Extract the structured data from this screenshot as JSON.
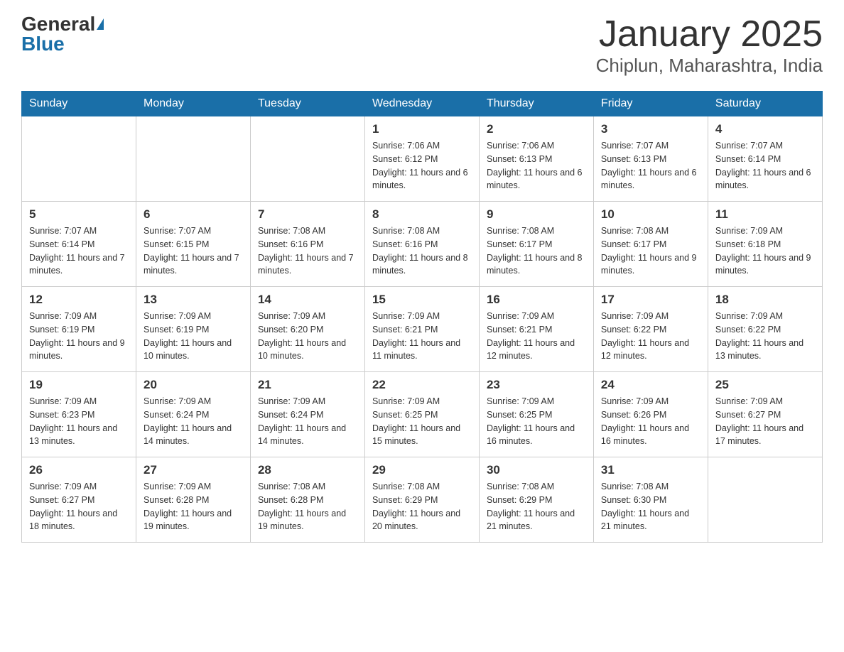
{
  "logo": {
    "general": "General",
    "blue": "Blue"
  },
  "title": "January 2025",
  "location": "Chiplun, Maharashtra, India",
  "headers": [
    "Sunday",
    "Monday",
    "Tuesday",
    "Wednesday",
    "Thursday",
    "Friday",
    "Saturday"
  ],
  "weeks": [
    [
      {
        "day": "",
        "info": ""
      },
      {
        "day": "",
        "info": ""
      },
      {
        "day": "",
        "info": ""
      },
      {
        "day": "1",
        "info": "Sunrise: 7:06 AM\nSunset: 6:12 PM\nDaylight: 11 hours and 6 minutes."
      },
      {
        "day": "2",
        "info": "Sunrise: 7:06 AM\nSunset: 6:13 PM\nDaylight: 11 hours and 6 minutes."
      },
      {
        "day": "3",
        "info": "Sunrise: 7:07 AM\nSunset: 6:13 PM\nDaylight: 11 hours and 6 minutes."
      },
      {
        "day": "4",
        "info": "Sunrise: 7:07 AM\nSunset: 6:14 PM\nDaylight: 11 hours and 6 minutes."
      }
    ],
    [
      {
        "day": "5",
        "info": "Sunrise: 7:07 AM\nSunset: 6:14 PM\nDaylight: 11 hours and 7 minutes."
      },
      {
        "day": "6",
        "info": "Sunrise: 7:07 AM\nSunset: 6:15 PM\nDaylight: 11 hours and 7 minutes."
      },
      {
        "day": "7",
        "info": "Sunrise: 7:08 AM\nSunset: 6:16 PM\nDaylight: 11 hours and 7 minutes."
      },
      {
        "day": "8",
        "info": "Sunrise: 7:08 AM\nSunset: 6:16 PM\nDaylight: 11 hours and 8 minutes."
      },
      {
        "day": "9",
        "info": "Sunrise: 7:08 AM\nSunset: 6:17 PM\nDaylight: 11 hours and 8 minutes."
      },
      {
        "day": "10",
        "info": "Sunrise: 7:08 AM\nSunset: 6:17 PM\nDaylight: 11 hours and 9 minutes."
      },
      {
        "day": "11",
        "info": "Sunrise: 7:09 AM\nSunset: 6:18 PM\nDaylight: 11 hours and 9 minutes."
      }
    ],
    [
      {
        "day": "12",
        "info": "Sunrise: 7:09 AM\nSunset: 6:19 PM\nDaylight: 11 hours and 9 minutes."
      },
      {
        "day": "13",
        "info": "Sunrise: 7:09 AM\nSunset: 6:19 PM\nDaylight: 11 hours and 10 minutes."
      },
      {
        "day": "14",
        "info": "Sunrise: 7:09 AM\nSunset: 6:20 PM\nDaylight: 11 hours and 10 minutes."
      },
      {
        "day": "15",
        "info": "Sunrise: 7:09 AM\nSunset: 6:21 PM\nDaylight: 11 hours and 11 minutes."
      },
      {
        "day": "16",
        "info": "Sunrise: 7:09 AM\nSunset: 6:21 PM\nDaylight: 11 hours and 12 minutes."
      },
      {
        "day": "17",
        "info": "Sunrise: 7:09 AM\nSunset: 6:22 PM\nDaylight: 11 hours and 12 minutes."
      },
      {
        "day": "18",
        "info": "Sunrise: 7:09 AM\nSunset: 6:22 PM\nDaylight: 11 hours and 13 minutes."
      }
    ],
    [
      {
        "day": "19",
        "info": "Sunrise: 7:09 AM\nSunset: 6:23 PM\nDaylight: 11 hours and 13 minutes."
      },
      {
        "day": "20",
        "info": "Sunrise: 7:09 AM\nSunset: 6:24 PM\nDaylight: 11 hours and 14 minutes."
      },
      {
        "day": "21",
        "info": "Sunrise: 7:09 AM\nSunset: 6:24 PM\nDaylight: 11 hours and 14 minutes."
      },
      {
        "day": "22",
        "info": "Sunrise: 7:09 AM\nSunset: 6:25 PM\nDaylight: 11 hours and 15 minutes."
      },
      {
        "day": "23",
        "info": "Sunrise: 7:09 AM\nSunset: 6:25 PM\nDaylight: 11 hours and 16 minutes."
      },
      {
        "day": "24",
        "info": "Sunrise: 7:09 AM\nSunset: 6:26 PM\nDaylight: 11 hours and 16 minutes."
      },
      {
        "day": "25",
        "info": "Sunrise: 7:09 AM\nSunset: 6:27 PM\nDaylight: 11 hours and 17 minutes."
      }
    ],
    [
      {
        "day": "26",
        "info": "Sunrise: 7:09 AM\nSunset: 6:27 PM\nDaylight: 11 hours and 18 minutes."
      },
      {
        "day": "27",
        "info": "Sunrise: 7:09 AM\nSunset: 6:28 PM\nDaylight: 11 hours and 19 minutes."
      },
      {
        "day": "28",
        "info": "Sunrise: 7:08 AM\nSunset: 6:28 PM\nDaylight: 11 hours and 19 minutes."
      },
      {
        "day": "29",
        "info": "Sunrise: 7:08 AM\nSunset: 6:29 PM\nDaylight: 11 hours and 20 minutes."
      },
      {
        "day": "30",
        "info": "Sunrise: 7:08 AM\nSunset: 6:29 PM\nDaylight: 11 hours and 21 minutes."
      },
      {
        "day": "31",
        "info": "Sunrise: 7:08 AM\nSunset: 6:30 PM\nDaylight: 11 hours and 21 minutes."
      },
      {
        "day": "",
        "info": ""
      }
    ]
  ]
}
